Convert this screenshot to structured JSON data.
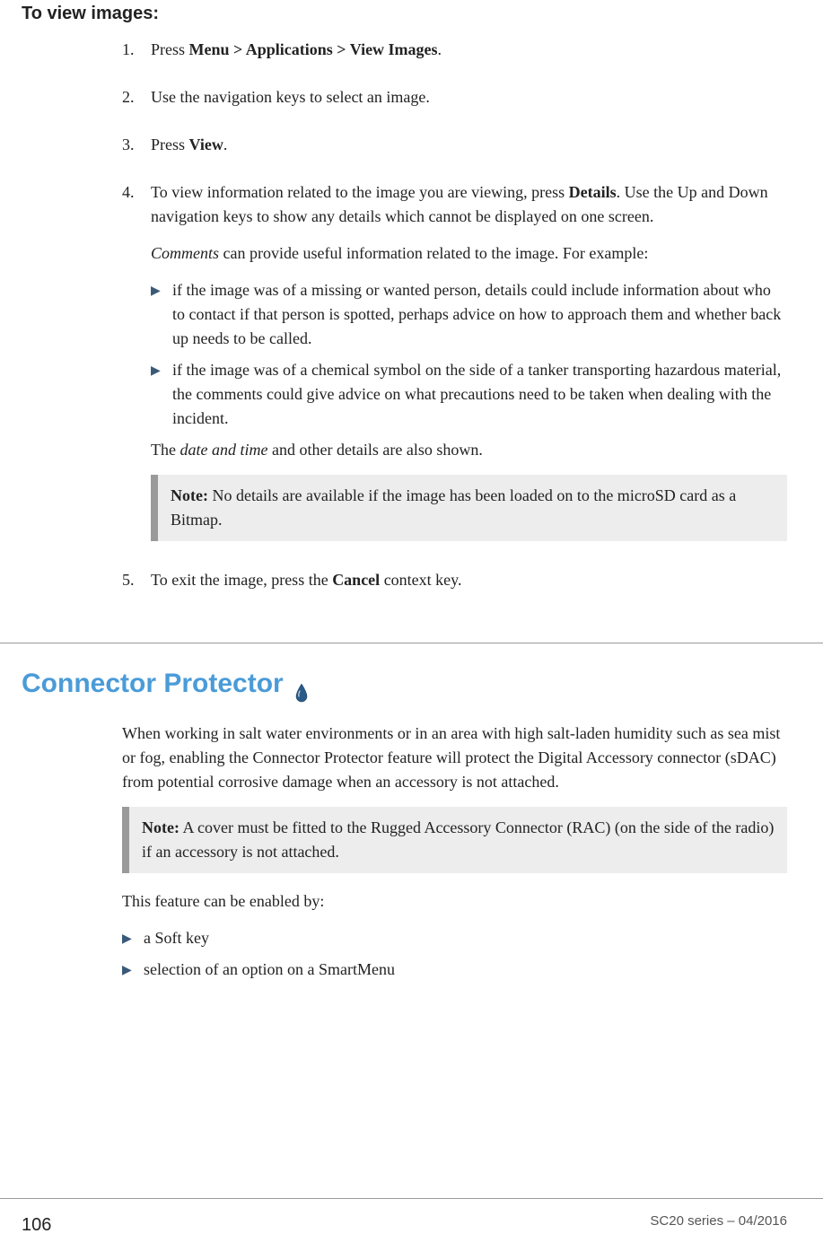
{
  "section1": {
    "title": "To view images:",
    "steps": [
      {
        "num": "1.",
        "parts": [
          {
            "t": "plain",
            "v": "Press "
          },
          {
            "t": "bold",
            "v": "Menu > Applications > View Images"
          },
          {
            "t": "plain",
            "v": "."
          }
        ]
      },
      {
        "num": "2.",
        "parts": [
          {
            "t": "plain",
            "v": "Use the navigation keys to select an image."
          }
        ]
      },
      {
        "num": "3.",
        "parts": [
          {
            "t": "plain",
            "v": "Press "
          },
          {
            "t": "bold",
            "v": "View"
          },
          {
            "t": "plain",
            "v": "."
          }
        ]
      },
      {
        "num": "4.",
        "parts": [
          {
            "t": "plain",
            "v": "To view information related to the image you are viewing, press "
          },
          {
            "t": "bold",
            "v": "Details"
          },
          {
            "t": "plain",
            "v": ". Use the Up and Down navigation keys to show any details which cannot be displayed on one screen."
          }
        ],
        "extra_para": [
          {
            "t": "italic",
            "v": "Comments"
          },
          {
            "t": "plain",
            "v": " can provide useful information related to the image. For example:"
          }
        ],
        "bullets": [
          "if the image was of a missing or wanted person, details could include information about who to contact if that person is spotted, perhaps advice on how to approach them and whether back up needs to be called.",
          "if the image was of a chemical symbol on the side of a tanker transporting hazardous material, the comments could give advice on what precautions need to be taken when dealing with the incident."
        ],
        "trailing_para": [
          {
            "t": "plain",
            "v": "The "
          },
          {
            "t": "italic",
            "v": "date and time"
          },
          {
            "t": "plain",
            "v": " and other details are also shown."
          }
        ],
        "note": {
          "label": "Note:",
          "text": "  No details are available if the image has been loaded on to the microSD card as a Bitmap."
        }
      },
      {
        "num": "5.",
        "parts": [
          {
            "t": "plain",
            "v": "To exit the image, press the "
          },
          {
            "t": "bold",
            "v": "Cancel"
          },
          {
            "t": "plain",
            "v": " context key."
          }
        ]
      }
    ]
  },
  "section2": {
    "title": "Connector Protector",
    "intro": "When working in salt water environments or in an area with high salt-laden humidity such as sea mist or fog, enabling the Connector Protector feature will protect the Digital Accessory connector (sDAC) from potential corrosive damage when an accessory is not attached.",
    "note": {
      "label": "Note:",
      "text": "  A cover must be fitted to the Rugged Accessory Connector (RAC) (on the side of the radio) if an accessory is not attached."
    },
    "enabled_by_text": "This feature can be enabled by:",
    "bullets": [
      "a Soft key",
      "selection of an option on a SmartMenu"
    ]
  },
  "footer": {
    "page_number": "106",
    "doc_id": "SC20 series – 04/2016"
  }
}
